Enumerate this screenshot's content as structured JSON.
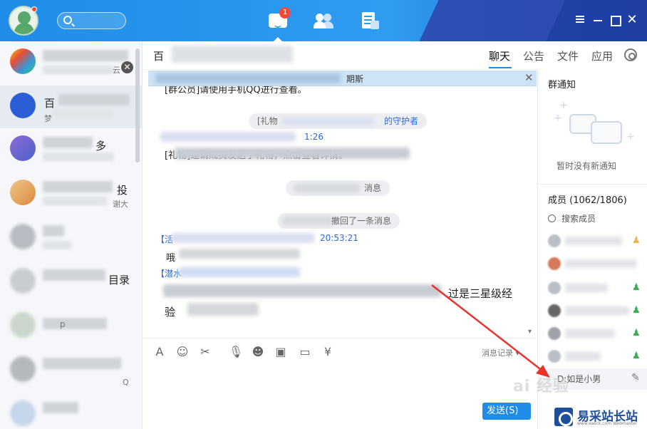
{
  "nav": {
    "message_badge": "1"
  },
  "sidebar": {
    "items": [
      {
        "title": "",
        "sub": "云"
      },
      {
        "title": "百",
        "sub": "梦"
      },
      {
        "title": "多",
        "sub": ""
      },
      {
        "title": "投",
        "sub": "谢大"
      },
      {
        "title": "",
        "sub": ""
      },
      {
        "title": "目录",
        "sub": ""
      },
      {
        "title": "p",
        "sub": ""
      },
      {
        "title": "Q",
        "sub": ""
      },
      {
        "title": "",
        "sub": ""
      }
    ]
  },
  "chat": {
    "title": "百",
    "tabs": [
      "聊天",
      "公告",
      "文件",
      "应用"
    ],
    "banner_suffix": "期斯",
    "messages": {
      "line1": "[群公员]请使用手机QQ进行查看。",
      "sys1_prefix": "[礼物",
      "sys1_suffix": "的守护者",
      "sender1_time": "1:26",
      "line2": "[礼物]邀请成员发送了礼物，点击查看详情。",
      "sys2": "消息",
      "sys3": "撤回了一条消息",
      "sender2_prefix": "【活",
      "sender2_time": "20:53:21",
      "line3": "哦",
      "sender3_prefix": "【潜水",
      "line4": "过是三星级经",
      "line5": "验"
    },
    "history_label": "消息记录",
    "send_label": "发送(S)"
  },
  "right_panel": {
    "notice_title": "群通知",
    "notice_empty": "暂时没有新通知",
    "members_title": "成员 (1062/1806)",
    "member_search": "搜索成员",
    "bottom_status": "D:如是小男"
  },
  "watermark": {
    "logo_name": "易采站长站",
    "logo_url": "www.easck.com Webmaster",
    "aibai": "ai 经验"
  }
}
